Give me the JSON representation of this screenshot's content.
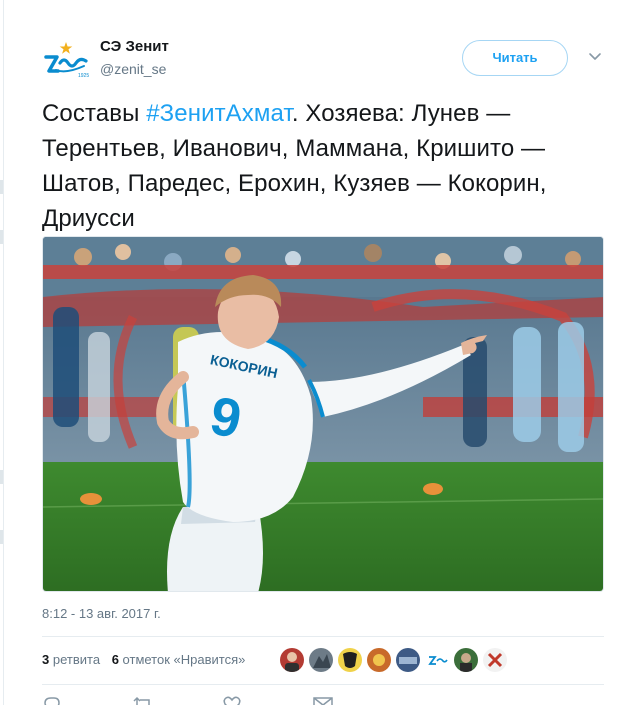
{
  "account": {
    "display_name": "СЭ Зенит",
    "handle": "@zenit_se"
  },
  "follow_button": {
    "label": "Читать"
  },
  "tweet": {
    "text_before": "Составы ",
    "hashtag": "#ЗенитАхмат",
    "text_after": ". Хозяева: Лунев — Терентьев, Иванович, Маммана, Кришито — Шатов, Паредес, Ерохин, Кузяев — Кокорин, Дриусси",
    "timestamp": "8:12 - 13 авг. 2017 г."
  },
  "photo": {
    "jersey_name": "КОКОРИН",
    "jersey_number": "9"
  },
  "stats": {
    "retweets_count": "3",
    "retweets_label": "ретвита",
    "likes_count": "6",
    "likes_label": "отметок «Нравится»"
  },
  "likers": [
    "avatar-1",
    "avatar-2",
    "avatar-3",
    "avatar-4",
    "avatar-5",
    "avatar-6",
    "avatar-7",
    "avatar-8"
  ],
  "colors": {
    "accent": "#1da1f2",
    "zenit_blue": "#0a8ccf",
    "text": "#14171a",
    "muted": "#657786"
  }
}
